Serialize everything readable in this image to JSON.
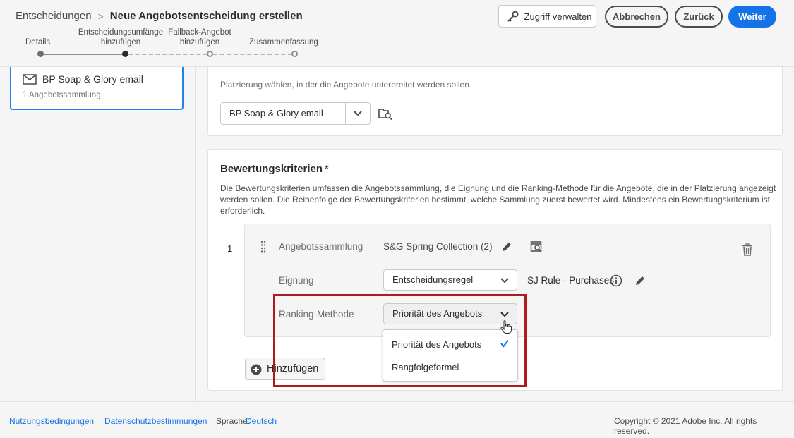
{
  "header": {
    "breadcrumb_parent": "Entscheidungen",
    "breadcrumb_sep": ">",
    "title": "Neue Angebotsentscheidung erstellen",
    "access_label": "Zugriff verwalten",
    "cancel_label": "Abbrechen",
    "back_label": "Zurück",
    "next_label": "Weiter"
  },
  "steps": [
    {
      "label": "Details",
      "state": "done"
    },
    {
      "label_line1": "Entscheidungsumfänge",
      "label_line2": "hinzufügen",
      "state": "active"
    },
    {
      "label_line1": "Fallback-Angebot",
      "label_line2": "hinzufügen",
      "state": "todo"
    },
    {
      "label": "Zusammenfassung",
      "state": "todo"
    }
  ],
  "sidebar": {
    "placement_name": "BP Soap & Glory email",
    "placement_sub": "1 Angebotssammlung"
  },
  "placement_panel": {
    "hint": "Platzierung wählen, in der die Angebote unterbreitet werden sollen.",
    "selected": "BP Soap & Glory email"
  },
  "criteria_panel": {
    "heading": "Bewertungskriterien",
    "required_mark": "*",
    "description": "Die Bewertungskriterien umfassen die Angebotssammlung, die Eignung und die Ranking-Methode für die Angebote, die in der Platzierung angezeigt werden sollen. Die Reihenfolge der Bewertungskriterien bestimmt, welche Sammlung zuerst bewertet wird. Mindestens ein Bewertungskriterium ist erforderlich.",
    "number": "1",
    "collection_label": "Angebotssammlung",
    "collection_value": "S&G Spring Collection (2)",
    "eligibility_label": "Eignung",
    "eligibility_value": "Entscheidungsregel",
    "rule_name": "SJ Rule - Purchases",
    "ranking_label": "Ranking-Methode",
    "ranking_value": "Priorität des Angebots",
    "add_label": "Hinzufügen"
  },
  "ranking_dropdown": {
    "options": [
      "Priorität des Angebots",
      "Rangfolgeformel"
    ],
    "selected_index": 0
  },
  "footer": {
    "terms": "Nutzungsbedingungen",
    "privacy": "Datenschutzbestimmungen",
    "language_label": "Sprache:",
    "language_value": "Deutsch",
    "copyright": "Copyright ©  2021 Adobe Inc.  All rights reserved."
  },
  "colors": {
    "accent": "#1473e6",
    "highlight": "#b0191e"
  }
}
